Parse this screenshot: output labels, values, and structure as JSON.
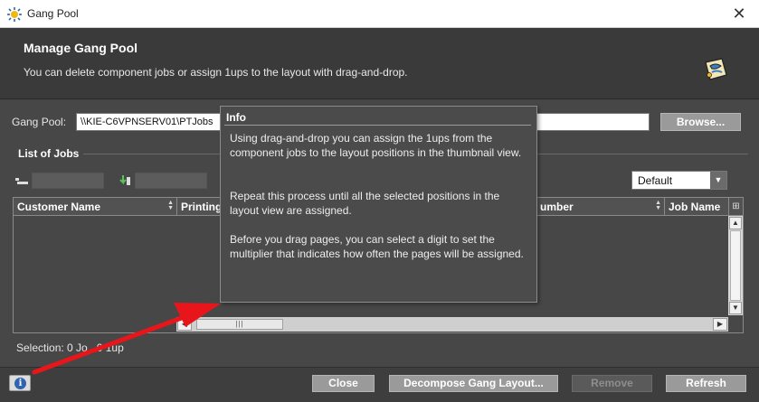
{
  "window": {
    "title": "Gang Pool",
    "close_symbol": "✕"
  },
  "header": {
    "title": "Manage Gang Pool",
    "description": "You can delete component jobs or assign 1ups to the layout with drag-and-drop."
  },
  "gang_pool": {
    "label": "Gang Pool:",
    "path_value": "\\\\KIE-C6VPNSERV01\\PTJobs",
    "browse_label": "Browse..."
  },
  "list_of_jobs": {
    "title": "List of Jobs",
    "view_select": {
      "selected": "Default"
    },
    "columns": [
      {
        "label": "Customer Name"
      },
      {
        "label": "Printing"
      },
      {
        "label": "umber"
      },
      {
        "label": "Job Name"
      }
    ]
  },
  "status": {
    "text": "Selection:  0 Jo    ,   0 1up"
  },
  "tooltip": {
    "title": "Info",
    "paragraphs": [
      "Using drag-and-drop you can assign the 1ups from the component jobs to the layout positions in the thumbnail view.",
      "Repeat this process until all the selected positions in the layout view are assigned.",
      "Before you drag pages, you can select a digit to set the multiplier that indicates how often the pages will be assigned."
    ]
  },
  "footer": {
    "info_symbol": "i",
    "close_label": "Close",
    "decompose_label": "Decompose Gang Layout...",
    "remove_label": "Remove",
    "refresh_label": "Refresh"
  },
  "colors": {
    "annotation_arrow": "#e8161a",
    "info_blue": "#2e64b0"
  }
}
